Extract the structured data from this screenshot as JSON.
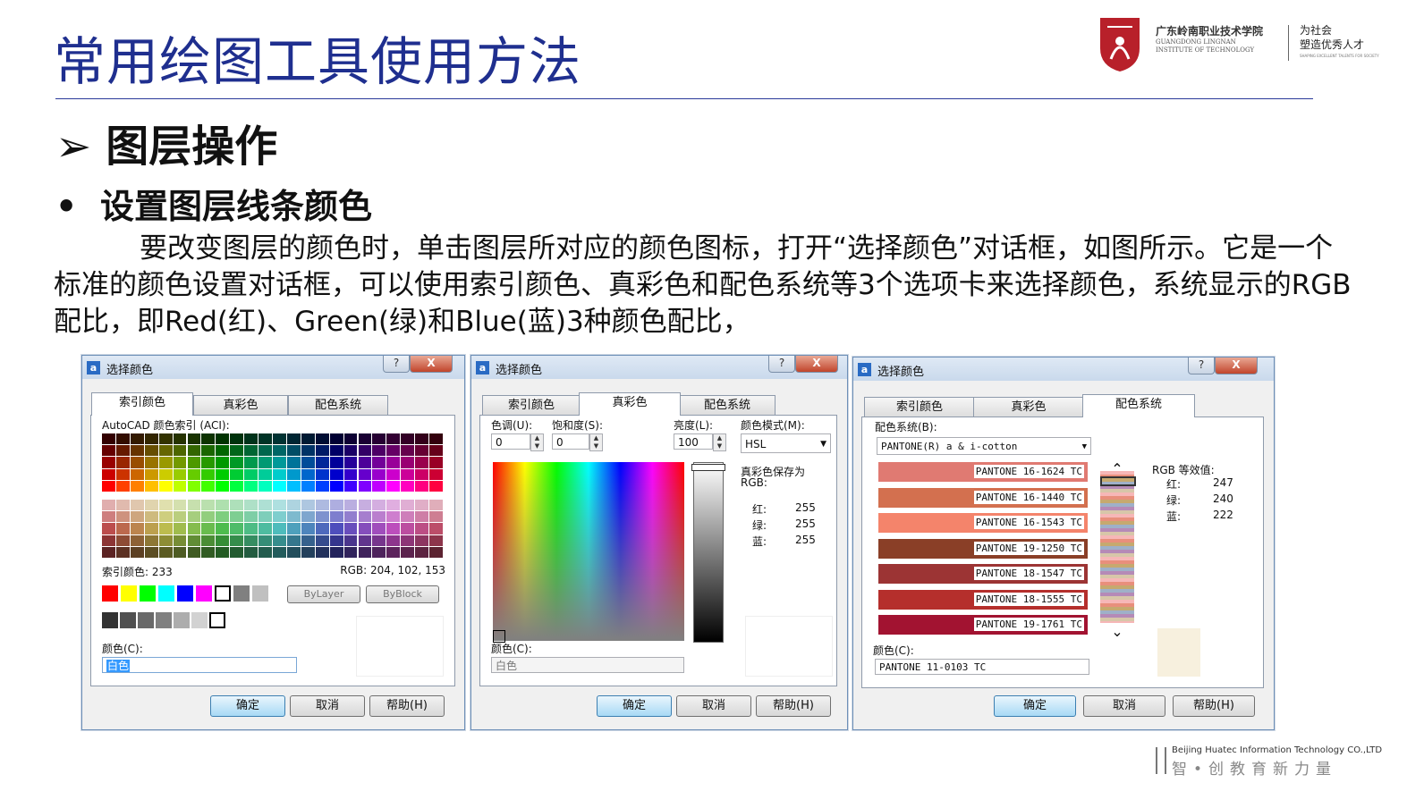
{
  "slide": {
    "title": "常用绘图工具使用方法",
    "heading": "图层操作",
    "heading_marker": "➢",
    "bullet": "设置图层线条颜色",
    "bullet_marker": "•",
    "paragraph": "要改变图层的颜色时，单击图层所对应的颜色图标，打开“选择颜色”对话框，如图所示。它是一个标准的颜色设置对话框，可以使用索引颜色、真彩色和配色系统等3个选项卡来选择颜色，系统显示的RGB配比，即Red(红)、Green(绿)和Blue(蓝)3种颜色配比，"
  },
  "logo": {
    "name_cn": "广东岭南职业技术学院",
    "name_en_1": "GUANGDONG LINGNAN",
    "name_en_2": "INSTITUTE OF TECHNOLOGY",
    "slogan_1": "为社会",
    "slogan_2": "塑造优秀人才",
    "slogan_en": "SHAPING EXCELLENT TALENTS FOR SOCIETY",
    "brand_color": "#b8202a"
  },
  "footer": {
    "company_en": "Beijing Huatec Information Technology CO.,LTD",
    "company_cn": "智•创教育新力量"
  },
  "dialogs": {
    "common": {
      "caption": "选择颜色",
      "help": "?",
      "close": "X",
      "tab_index": "索引颜色",
      "tab_true": "真彩色",
      "tab_book": "配色系统",
      "ok": "确定",
      "cancel": "取消",
      "help_btn": "帮助(H)",
      "color_label": "颜色(C):"
    },
    "index": {
      "aci_label": "AutoCAD 颜色索引 (ACI):",
      "index_label": "索引颜色: 233",
      "rgb_label": "RGB: 204, 102, 153",
      "bylayer": "ByLayer",
      "byblock": "ByBlock",
      "color_value": "白色",
      "standard_colors": [
        "#ff0000",
        "#ffff00",
        "#00ff00",
        "#00ffff",
        "#0000ff",
        "#ff00ff",
        "#ffffff",
        "#808080",
        "#c0c0c0"
      ],
      "gray_colors": [
        "#333333",
        "#505050",
        "#696969",
        "#808080",
        "#adadad",
        "#d2d2d2",
        "#ffffff"
      ]
    },
    "truecolor": {
      "hue_label": "色调(U):",
      "sat_label": "饱和度(S):",
      "lum_label": "亮度(L):",
      "model_label": "颜色模式(M):",
      "hue": "0",
      "sat": "0",
      "lum": "100",
      "model": "HSL",
      "saved_label": "真彩色保存为",
      "rgb_label": "RGB:",
      "red_label": "红:",
      "green_label": "绿:",
      "blue_label": "蓝:",
      "red": "255",
      "green": "255",
      "blue": "255",
      "color_value": "白色"
    },
    "colorbook": {
      "book_label": "配色系统(B):",
      "book_value": "PANTONE(R) a & i-cotton",
      "swatches": [
        {
          "name": "PANTONE 16-1624 TC",
          "color": "#e07a72"
        },
        {
          "name": "PANTONE 16-1440 TC",
          "color": "#d3704f"
        },
        {
          "name": "PANTONE 16-1543 TC",
          "color": "#f4846b"
        },
        {
          "name": "PANTONE 19-1250 TC",
          "color": "#8a3f27"
        },
        {
          "name": "PANTONE 18-1547 TC",
          "color": "#9c3434"
        },
        {
          "name": "PANTONE 18-1555 TC",
          "color": "#b52f2c"
        },
        {
          "name": "PANTONE 19-1761 TC",
          "color": "#a21331"
        }
      ],
      "equiv_label": "RGB 等效值:",
      "red_label": "红:",
      "green_label": "绿:",
      "blue_label": "蓝:",
      "red": "247",
      "green": "240",
      "blue": "222",
      "preview_color": "#f7f0de",
      "color_value": "PANTONE 11-0103 TC"
    }
  }
}
